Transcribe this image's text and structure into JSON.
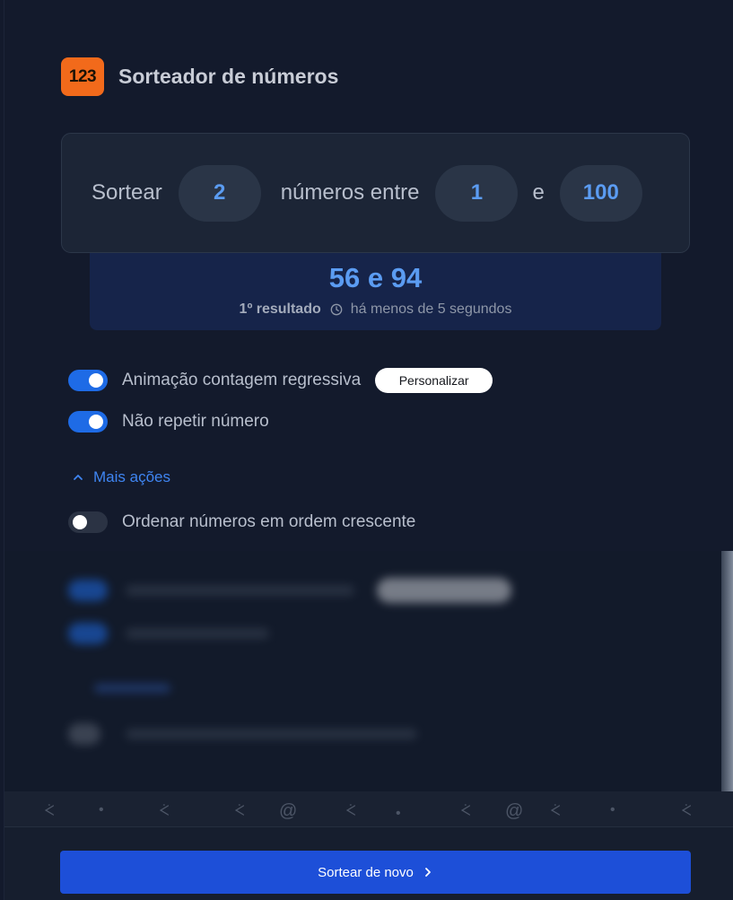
{
  "header": {
    "logo_text": "123",
    "title": "Sorteador de números"
  },
  "config": {
    "prefix": "Sortear",
    "quantity": "2",
    "middle": "números entre",
    "min": "1",
    "connector": "e",
    "max": "100"
  },
  "result": {
    "numbers": "56 e 94",
    "ordinal": "1º resultado",
    "time": "há menos de 5 segundos"
  },
  "options": {
    "countdown": {
      "label": "Animação contagem regressiva",
      "enabled": true,
      "button": "Personalizar"
    },
    "no_repeat": {
      "label": "Não repetir número",
      "enabled": true
    },
    "more_actions": "Mais ações",
    "sort_ascending": {
      "label": "Ordenar números em ordem crescente",
      "enabled": false
    }
  },
  "footer": {
    "cta_label": "Sortear de novo"
  },
  "colors": {
    "accent": "#1d4fd8",
    "brand": "#f26a1b",
    "result": "#5b9cf2"
  }
}
